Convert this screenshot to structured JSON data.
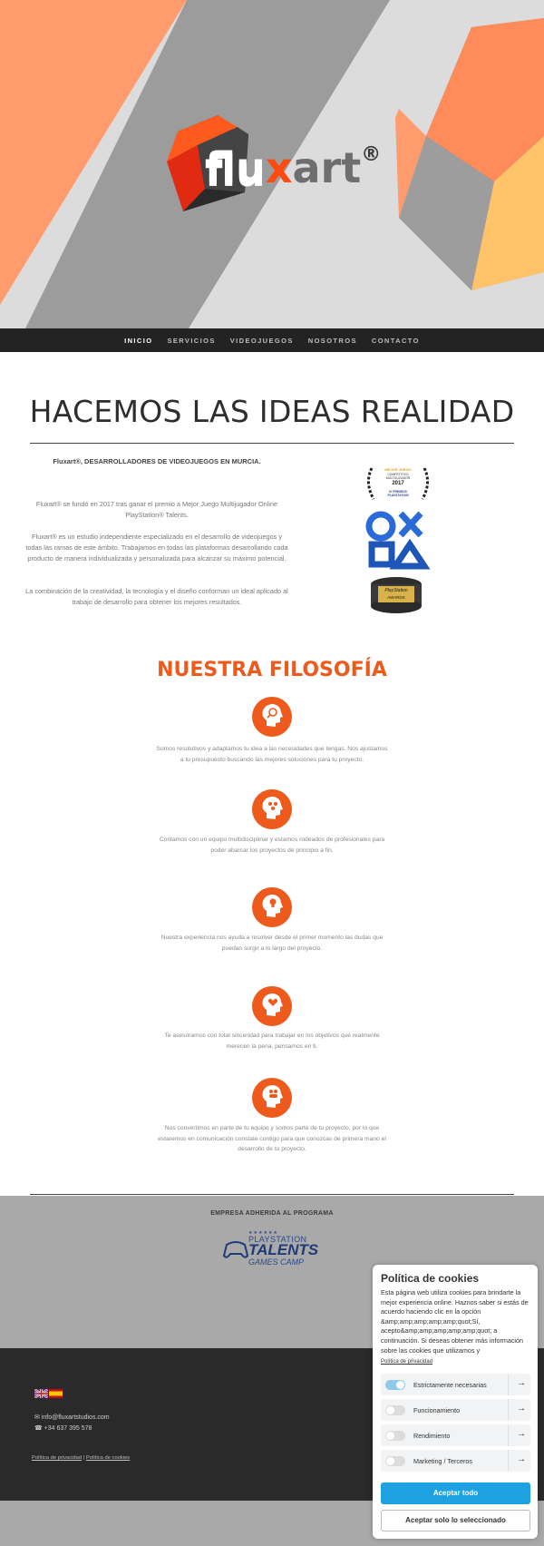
{
  "hero": {
    "logo_text_prefix": "flu",
    "logo_text_x": "x",
    "logo_text_suffix": "art",
    "logo_registered": "®",
    "colors": {
      "orange": "#ff9b6d",
      "gray": "#9a9a9a",
      "light": "#dcdcdc",
      "brand_orange": "#ee5a1c"
    }
  },
  "nav": {
    "items": [
      {
        "label": "INICIO",
        "active": true
      },
      {
        "label": "SERVICIOS",
        "active": false
      },
      {
        "label": "VIDEOJUEGOS",
        "active": false
      },
      {
        "label": "NOSOTROS",
        "active": false
      },
      {
        "label": "CONTACTO",
        "active": false
      }
    ]
  },
  "main": {
    "headline": "HACEMOS LAS IDEAS REALIDAD",
    "intro_heading": "Fluxart®, DESARROLLADORES DE VIDEOJUEGOS EN MURCIA.",
    "intro_paragraphs": [
      "Fluxart® se fundó en 2017 tras ganar el premio a Mejor Juego Multijugador Online PlayStation® Talents.",
      "Fluxart® es un estudio independiente especializado en el desarrollo de videojuegos y todas las ramas de este ámbito. Trabajamos en todas las plataformas desarrollando cada producto de manera individualizada y personalizada para alcanzar su máximo potencial.",
      "La combinación de la creatividad, la tecnología y el diseño conforman un ideal aplicado al trabajo de desarrollo para obtener los mejores resultados."
    ],
    "award": {
      "laurel_line1": "MEJOR JUEGO",
      "laurel_line2": "COMPETITIVO",
      "laurel_line3": "MULTIJUGADOR",
      "laurel_year": "2017",
      "laurel_footer1": "IV PREMIOS",
      "laurel_footer2": "PLAYSTATION",
      "plate_line1": "PlayStation",
      "plate_line2": "AWARDS"
    }
  },
  "philosophy": {
    "title": "NUESTRA FILOSOFÍA",
    "items": [
      {
        "icon": "head-search-icon",
        "text": "Somos resolutivos y adaptamos tu idea a las necesidades que tengas. Nos ajustamos a tu presupuesto buscando las mejores soluciones para tu proyecto."
      },
      {
        "icon": "head-team-icon",
        "text": "Contamos con un equipo multidisciplinar y estamos rodeados de profesionales para poder abarcar los proyectos de principio a fin."
      },
      {
        "icon": "head-idea-icon",
        "text": "Nuestra experiencia nos ayuda a resolver desde el primer momento las dudas que puedan surgir a lo largo del proyecto."
      },
      {
        "icon": "head-heart-icon",
        "text": "Te asesoramos con total sinceridad para trabajar en los objetivos que realmente merecen la pena, pensamos en ti."
      },
      {
        "icon": "head-people-icon",
        "text": "Nos convertimos en parte de tu equipo y somos parte de tu proyecto, por lo que estaremos en comunicación constate contigo para que conozcas de primera mano el desarrollo de tu proyecto."
      }
    ]
  },
  "program": {
    "label": "EMPRESA ADHERIDA AL PROGRAMA",
    "stars": "★★★★★★",
    "logo_line1": "PLAYSTATION",
    "logo_line2": "TALENTS",
    "logo_line3": "GAMES CAMP"
  },
  "footer": {
    "email": "info@fluxartstudios.com",
    "phone": "+34 637 395 578",
    "link_privacy": "Política de privacidad",
    "separator": "|",
    "link_cookies": "Política de cookies"
  },
  "cookie_panel": {
    "title": "Política de cookies",
    "body": "Esta página web utiliza cookies para brindarte la mejor experiencia online. Haznos saber si estás de acuerdo haciendo clic en la opción &amp;amp;amp;amp;amp;quot;Sí, acepto&amp;amp;amp;amp;amp;quot; a continuación. Si deseas obtener más información sobre las cookies que utilizamos y",
    "policy_link": "Política de privacidad",
    "rows": [
      {
        "label": "Estrictamente necesarias",
        "on": true
      },
      {
        "label": "Funcionamiento",
        "on": false
      },
      {
        "label": "Rendimiento",
        "on": false
      },
      {
        "label": "Marketing / Terceros",
        "on": false
      }
    ],
    "accept_all": "Aceptar todo",
    "accept_selected": "Aceptar solo lo seleccionado"
  }
}
